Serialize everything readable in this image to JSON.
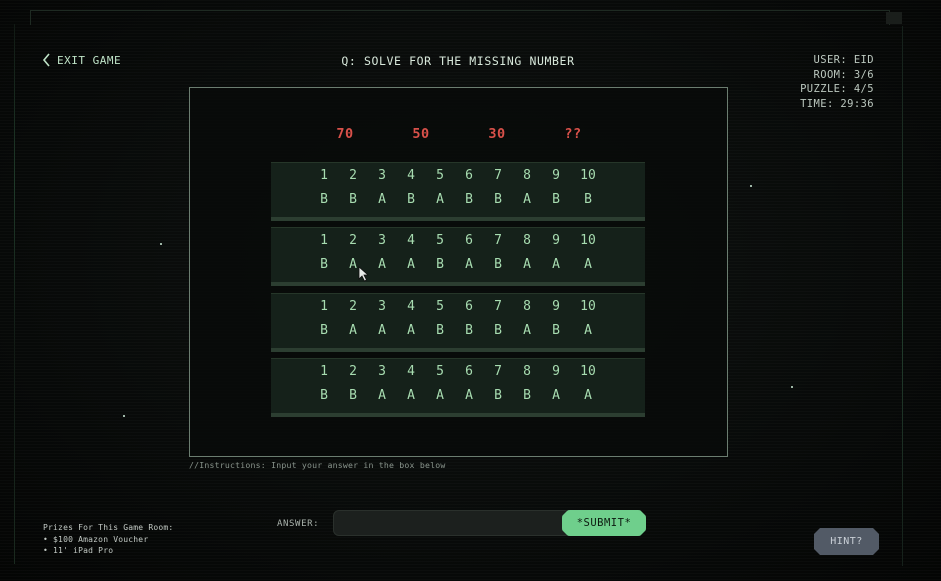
{
  "header": {
    "exit_label": "EXIT GAME",
    "question": "Q: SOLVE FOR THE MISSING NUMBER"
  },
  "stats": {
    "user": "USER: EID",
    "room": "ROOM: 3/6",
    "puzzle": "PUZZLE: 4/5",
    "time": "TIME: 29:36"
  },
  "puzzle": {
    "targets": [
      "70",
      "50",
      "30",
      "??"
    ],
    "numbers": [
      "1",
      "2",
      "3",
      "4",
      "5",
      "6",
      "7",
      "8",
      "9",
      "10"
    ],
    "rows": [
      [
        "B",
        "B",
        "A",
        "B",
        "A",
        "B",
        "B",
        "A",
        "B",
        "B"
      ],
      [
        "B",
        "A",
        "A",
        "A",
        "B",
        "A",
        "B",
        "A",
        "A",
        "A"
      ],
      [
        "B",
        "A",
        "A",
        "A",
        "B",
        "B",
        "B",
        "A",
        "B",
        "A"
      ],
      [
        "B",
        "B",
        "A",
        "A",
        "A",
        "A",
        "B",
        "B",
        "A",
        "A"
      ]
    ]
  },
  "instructions": "//Instructions: Input your answer in the box below",
  "answer": {
    "label": "ANSWER:",
    "value": "",
    "placeholder": "",
    "submit_label": "*SUBMIT*"
  },
  "hint": {
    "label": "HINT?"
  },
  "prizes": {
    "title": "Prizes For This Game Room:",
    "items": [
      "$100 Amazon Voucher",
      "11' iPad Pro"
    ]
  },
  "colors": {
    "accent_green": "#6fcf8c",
    "target_red": "#d9514a",
    "card_bg": "#15211a",
    "hint_bg": "#525a66"
  },
  "icons": {
    "exit": "chevron-left-icon",
    "cursor": "mouse-pointer-icon"
  }
}
